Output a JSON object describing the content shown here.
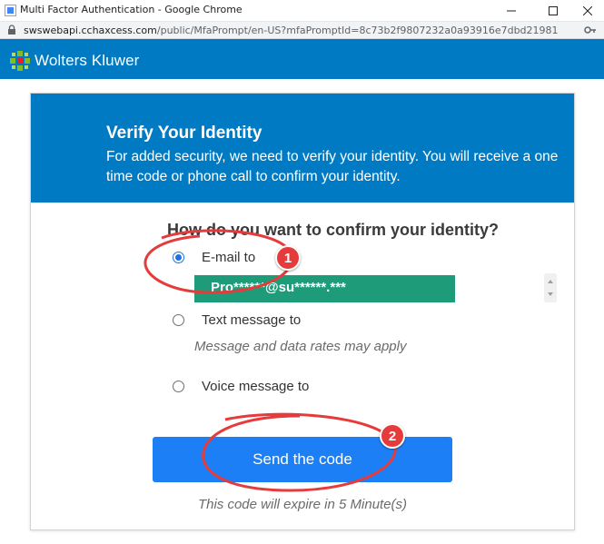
{
  "window": {
    "title": "Multi Factor Authentication - Google Chrome",
    "controls": {
      "minimize": "–",
      "maximize": "☐",
      "close": "✕"
    }
  },
  "address_bar": {
    "host": "swswebapi.cchaxcess.com",
    "path": "/public/MfaPrompt/en-US?mfaPromptId=8c73b2f9807232a0a93916e7dbd21981"
  },
  "site_header": {
    "brand": "Wolters Kluwer"
  },
  "card": {
    "title": "Verify Your Identity",
    "description": "For added security, we need to verify your identity. You will receive a one time code or phone call to confirm your identity.",
    "question": "How do you want to confirm your identity?",
    "options": [
      {
        "label": "E-mail to",
        "checked": true
      },
      {
        "label": "Text message to",
        "checked": false
      },
      {
        "label": "Voice message to",
        "checked": false
      }
    ],
    "email_selected": "Pro******@su******.***",
    "text_hint": "Message and data rates may apply",
    "send_button": "Send the code",
    "expire_note": "This code will expire in 5 Minute(s)"
  },
  "annotations": {
    "badge_1": "1",
    "badge_2": "2",
    "color": "#e63b3b"
  },
  "colors": {
    "brand_blue": "#007ac3",
    "button_blue": "#1c7ff5",
    "selected_green": "#1e9b78"
  }
}
